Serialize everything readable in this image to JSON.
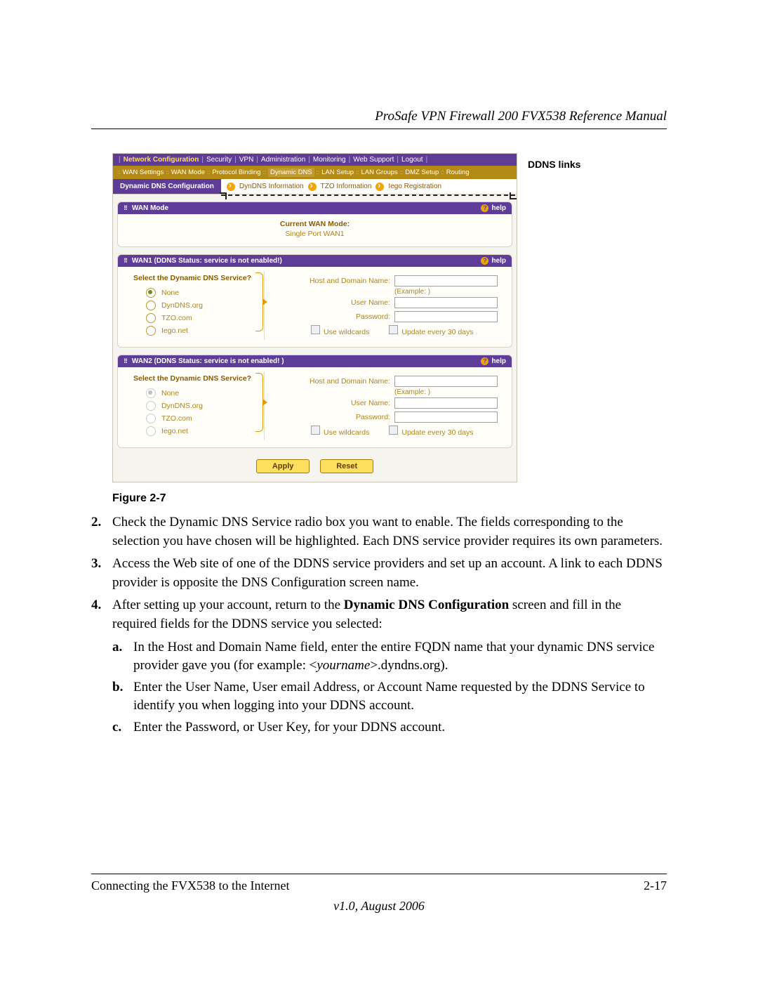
{
  "doc": {
    "title": "ProSafe VPN Firewall 200 FVX538 Reference Manual",
    "figure_caption": "Figure 2-7",
    "annotation": "DDNS links",
    "footer_left": "Connecting the FVX538 to the Internet",
    "footer_right": "2-17",
    "footer_version": "v1.0, August 2006"
  },
  "nav": {
    "items": [
      "Network Configuration",
      "Security",
      "VPN",
      "Administration",
      "Monitoring",
      "Web Support",
      "Logout"
    ],
    "sub_items": [
      "WAN Settings",
      "WAN Mode",
      "Protocol Binding",
      "Dynamic DNS",
      "LAN Setup",
      "LAN Groups",
      "DMZ Setup",
      "Routing"
    ],
    "linkbar_left": "Dynamic DNS Configuration",
    "linkbar_links": [
      "DynDNS Information",
      "TZO Information",
      "Iego Registration"
    ]
  },
  "panels": {
    "wanmode": {
      "title": "WAN Mode",
      "help": "help",
      "heading": "Current WAN Mode:",
      "value": "Single Port WAN1"
    },
    "wan1": {
      "title": "WAN1 (DDNS Status: service is not enabled!)",
      "select_label": "Select the Dynamic DNS Service?",
      "options": [
        "None",
        "DynDNS.org",
        "TZO.com",
        "Iego.net"
      ],
      "host_label": "Host and Domain Name:",
      "example": "(Example: )",
      "user_label": "User Name:",
      "pass_label": "Password:",
      "wildcards": "Use wildcards",
      "update30": "Update every 30 days"
    },
    "wan2": {
      "title": "WAN2 (DDNS Status: service is not enabled! )"
    },
    "buttons": {
      "apply": "Apply",
      "reset": "Reset"
    }
  },
  "text": {
    "step2": "Check the Dynamic DNS Service radio box you want to enable. The fields corresponding to the selection you have chosen will be highlighted. Each DNS service provider requires its own parameters.",
    "step3": "Access the Web site of one of the DDNS service providers and set up an account. A link to each DDNS provider is opposite the DNS Configuration screen name.",
    "step4_a": "After setting up your account, return to the ",
    "step4_bold": "Dynamic DNS Configuration",
    "step4_b": " screen and fill in the required fields for the DDNS service you selected:",
    "sub_a_a": "In the Host and Domain Name field, enter the entire FQDN name that your dynamic DNS service provider gave you (for example: <",
    "sub_a_ital": "yourname",
    "sub_a_b": ">.dyndns.org).",
    "sub_b": "Enter the User Name, User email Address, or Account Name requested by the DDNS Service to identify you when logging into your DDNS account.",
    "sub_c": "Enter the Password, or User Key, for your DDNS account."
  }
}
